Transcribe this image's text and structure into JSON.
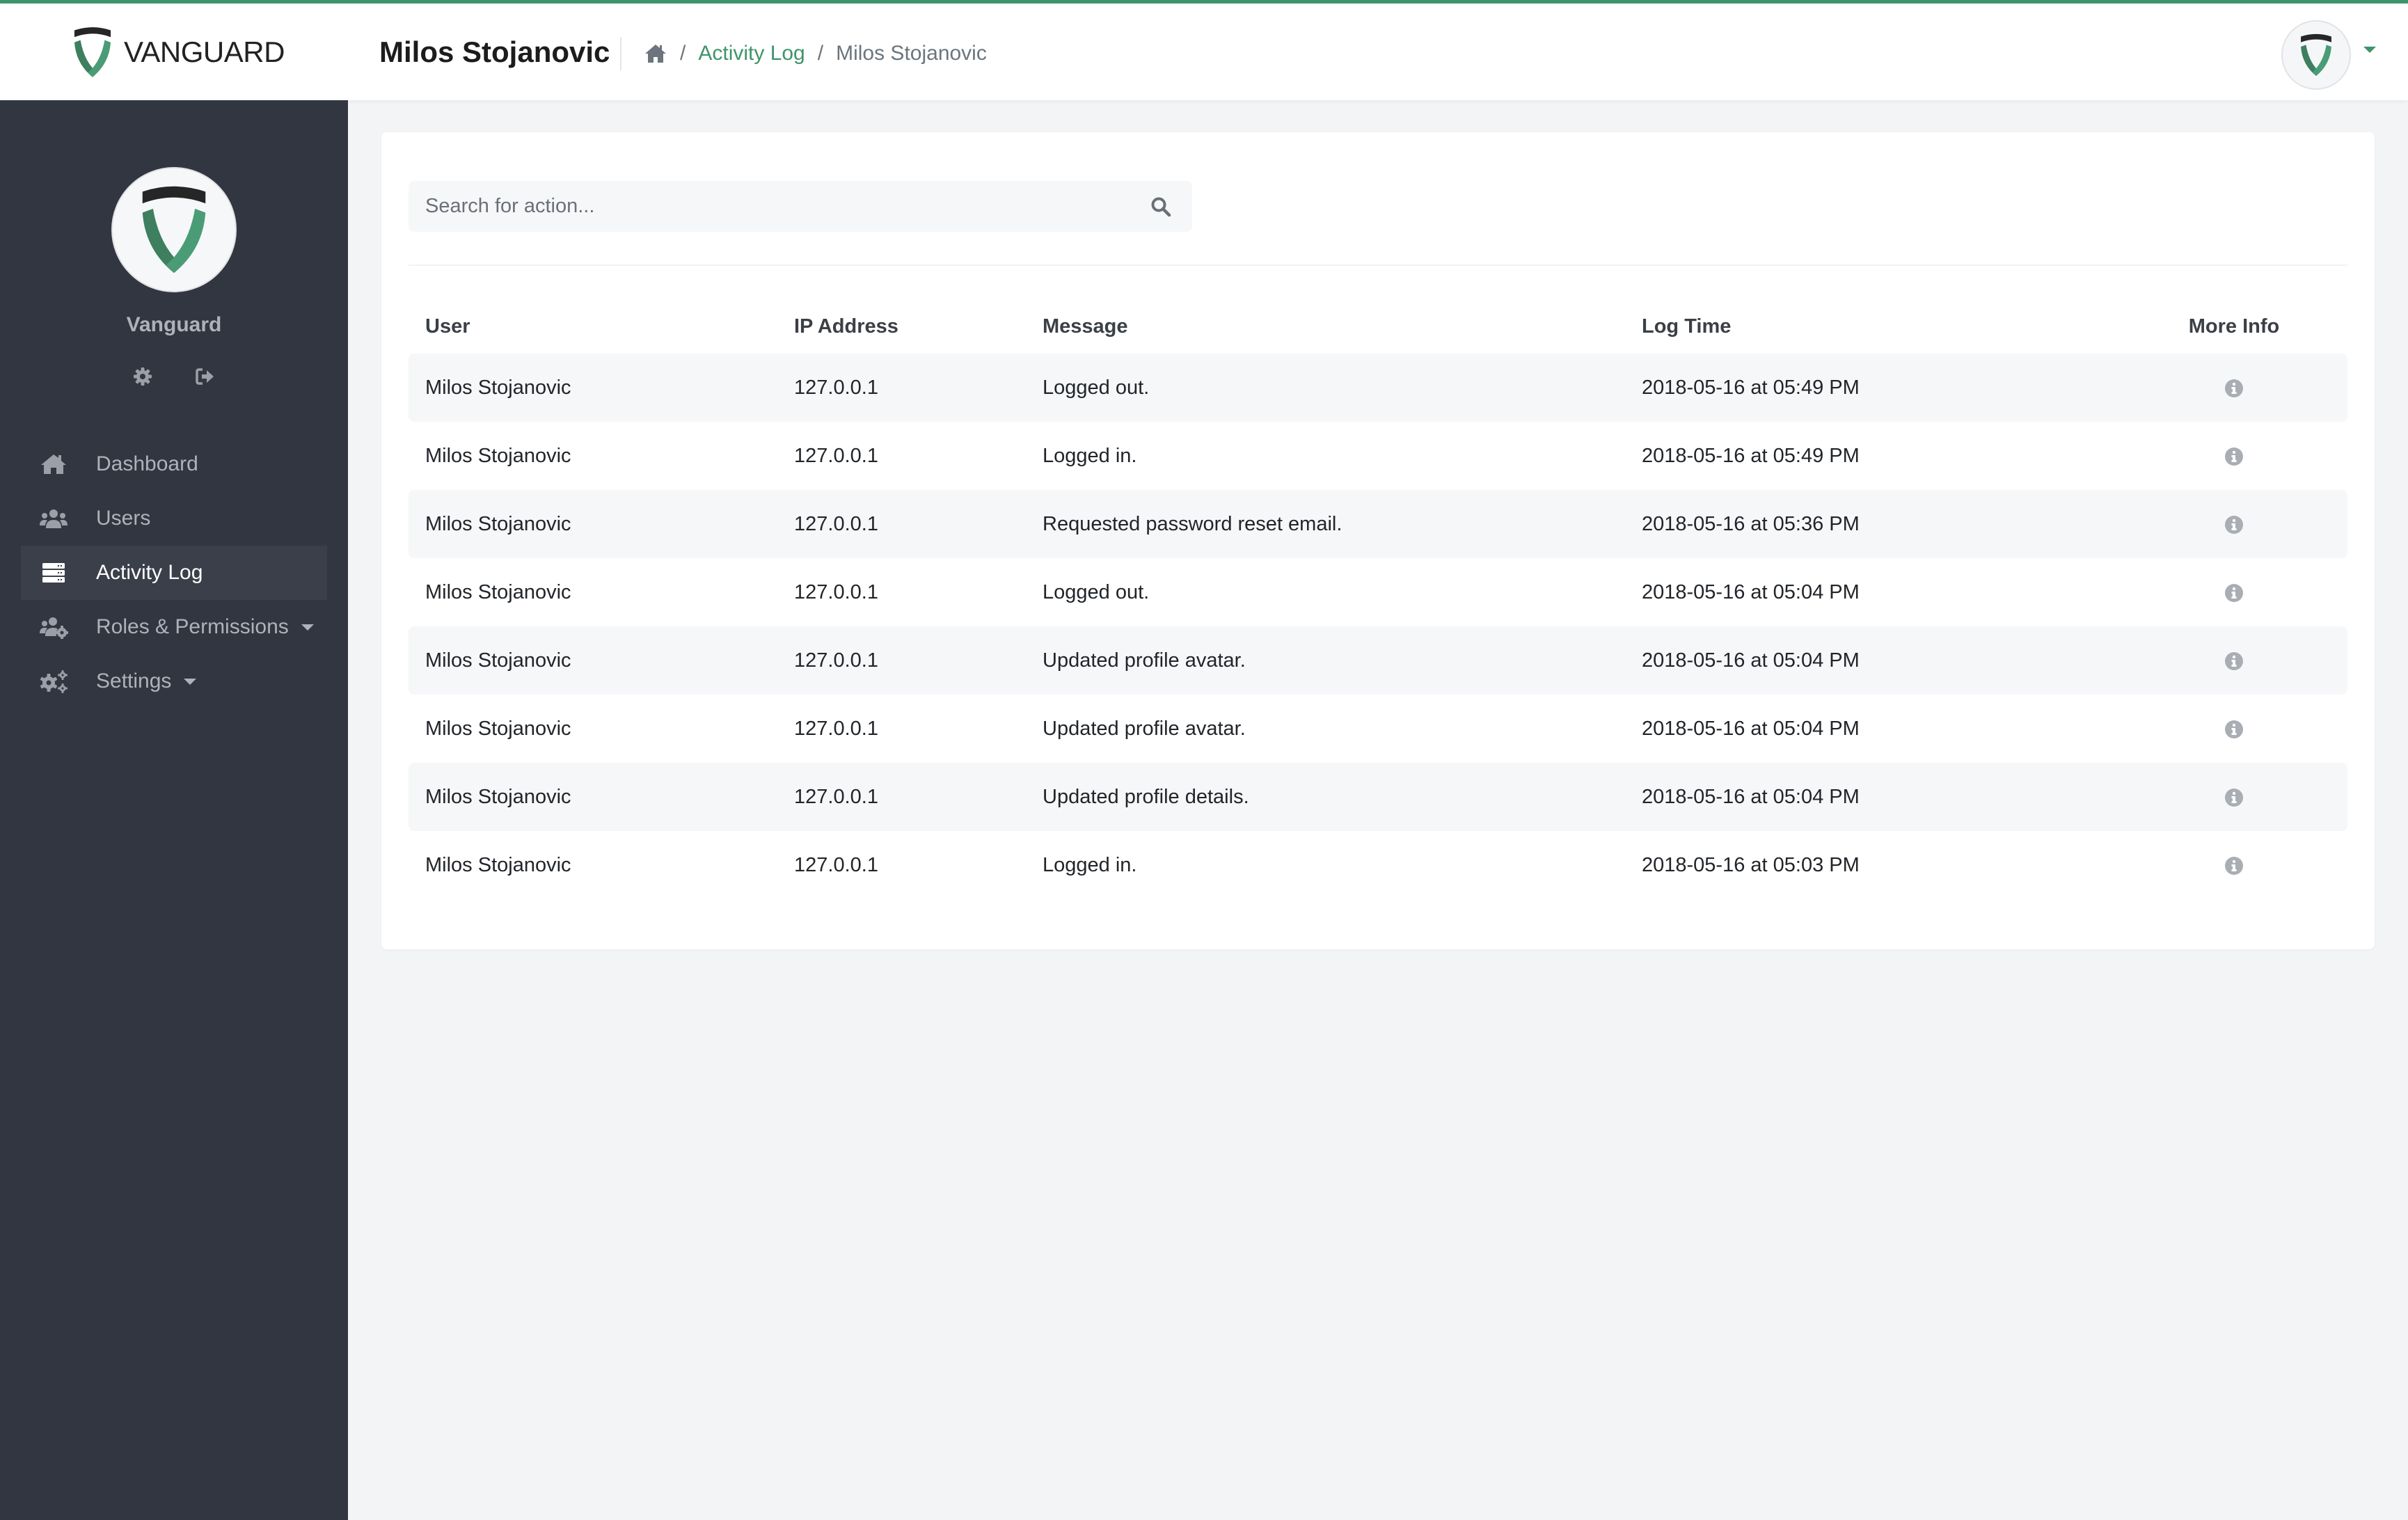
{
  "app": {
    "brand_name": "VANGUARD",
    "accent_color": "#3f946a",
    "sidebar_color": "#323640"
  },
  "header": {
    "page_title": "Milos Stojanovic",
    "breadcrumb": {
      "home_icon": "home-icon",
      "separator": "/",
      "items": [
        {
          "label": "Activity Log",
          "link": true
        },
        {
          "label": "Milos Stojanovic",
          "link": false
        }
      ]
    },
    "user_menu": {
      "avatar": "vanguard-logo",
      "caret": "caret-down-icon"
    }
  },
  "sidebar": {
    "profile_name": "Vanguard",
    "profile_actions": [
      {
        "icon": "gear-icon",
        "label": "Settings"
      },
      {
        "icon": "sign-out-icon",
        "label": "Logout"
      }
    ],
    "items": [
      {
        "label": "Dashboard",
        "icon": "home-icon",
        "active": false,
        "has_dropdown": false
      },
      {
        "label": "Users",
        "icon": "users-icon",
        "active": false,
        "has_dropdown": false
      },
      {
        "label": "Activity Log",
        "icon": "server-icon",
        "active": true,
        "has_dropdown": false
      },
      {
        "label": "Roles & Permissions",
        "icon": "users-cog-icon",
        "active": false,
        "has_dropdown": true
      },
      {
        "label": "Settings",
        "icon": "cogs-icon",
        "active": false,
        "has_dropdown": true
      }
    ]
  },
  "search": {
    "placeholder": "Search for action...",
    "value": ""
  },
  "table": {
    "columns": [
      "User",
      "IP Address",
      "Message",
      "Log Time",
      "More Info"
    ],
    "rows": [
      {
        "user": "Milos Stojanovic",
        "ip": "127.0.0.1",
        "message": "Logged out.",
        "time": "2018-05-16 at 05:49 PM"
      },
      {
        "user": "Milos Stojanovic",
        "ip": "127.0.0.1",
        "message": "Logged in.",
        "time": "2018-05-16 at 05:49 PM"
      },
      {
        "user": "Milos Stojanovic",
        "ip": "127.0.0.1",
        "message": "Requested password reset email.",
        "time": "2018-05-16 at 05:36 PM"
      },
      {
        "user": "Milos Stojanovic",
        "ip": "127.0.0.1",
        "message": "Logged out.",
        "time": "2018-05-16 at 05:04 PM"
      },
      {
        "user": "Milos Stojanovic",
        "ip": "127.0.0.1",
        "message": "Updated profile avatar.",
        "time": "2018-05-16 at 05:04 PM"
      },
      {
        "user": "Milos Stojanovic",
        "ip": "127.0.0.1",
        "message": "Updated profile avatar.",
        "time": "2018-05-16 at 05:04 PM"
      },
      {
        "user": "Milos Stojanovic",
        "ip": "127.0.0.1",
        "message": "Updated profile details.",
        "time": "2018-05-16 at 05:04 PM"
      },
      {
        "user": "Milos Stojanovic",
        "ip": "127.0.0.1",
        "message": "Logged in.",
        "time": "2018-05-16 at 05:03 PM"
      }
    ]
  }
}
